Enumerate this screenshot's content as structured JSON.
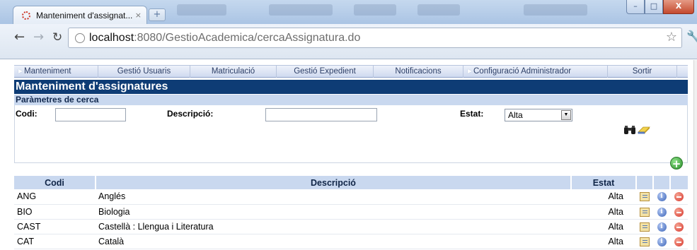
{
  "browser": {
    "tab_title": "Manteniment d'assignat...",
    "tab_close": "×",
    "new_tab": "+",
    "url_host": "localhost",
    "url_rest": ":8080/GestioAcademica/cercaAssignatura.do",
    "window_min": "–",
    "window_max": "□",
    "window_close": "X"
  },
  "menu": {
    "items": [
      {
        "label": "Manteniment"
      },
      {
        "label": "Gestió Usuaris"
      },
      {
        "label": "Matriculació"
      },
      {
        "label": "Gestió Expedient"
      },
      {
        "label": "Notificacions"
      },
      {
        "label": "Configuració Administrador"
      },
      {
        "label": "Sortir"
      }
    ]
  },
  "page": {
    "title": "Manteniment d'assignatures",
    "search_header": "Paràmetres de cerca"
  },
  "search": {
    "codi_label": "Codi:",
    "codi_value": "",
    "descripcio_label": "Descripció:",
    "descripcio_value": "",
    "estat_label": "Estat:",
    "estat_selected": "Alta"
  },
  "table": {
    "headers": {
      "codi": "Codi",
      "descripcio": "Descripció",
      "estat": "Estat"
    },
    "rows": [
      {
        "codi": "ANG",
        "descripcio": "Anglés",
        "estat": "Alta"
      },
      {
        "codi": "BIO",
        "descripcio": "Biologia",
        "estat": "Alta"
      },
      {
        "codi": "CAST",
        "descripcio": "Castellà : Llengua i Literatura",
        "estat": "Alta"
      },
      {
        "codi": "CAT",
        "descripcio": "Català",
        "estat": "Alta"
      }
    ]
  },
  "colors": {
    "title_bar": "#0e3c75",
    "header_bg": "#c9d8ef",
    "add_green": "#2b8f2b",
    "delete_red": "#d6352b",
    "info_blue": "#3a63b6"
  }
}
